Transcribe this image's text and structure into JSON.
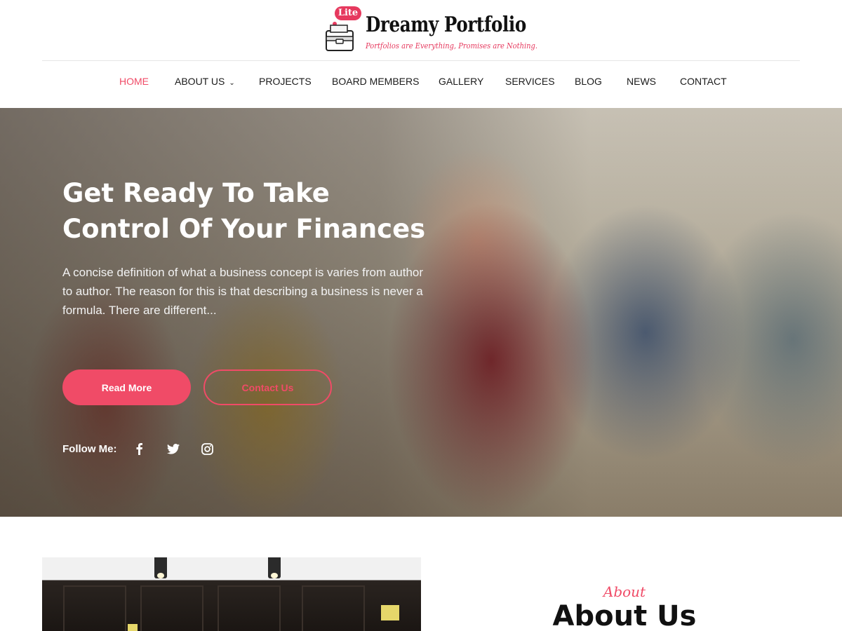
{
  "brand": {
    "badge": "Lite",
    "name": "Dreamy Portfolio",
    "tagline": "Portfolios are Everything, Promises are Nothing."
  },
  "nav": {
    "items": [
      {
        "label": "HOME",
        "active": true
      },
      {
        "label": "ABOUT US",
        "has_dropdown": true
      },
      {
        "label": "PROJECTS"
      },
      {
        "label": "BOARD MEMBERS"
      },
      {
        "label": "GALLERY"
      },
      {
        "label": "SERVICES"
      },
      {
        "label": "BLOG"
      },
      {
        "label": "NEWS"
      },
      {
        "label": "CONTACT"
      }
    ]
  },
  "hero": {
    "title": "Get Ready To Take Control Of Your Finances",
    "text": "A concise definition of what a business concept is varies from author to author. The reason for this is that describing a business is never a formula. There are different...",
    "primary_button": "Read More",
    "secondary_button": "Contact Us",
    "follow_label": "Follow Me:",
    "social_icons": [
      "facebook-icon",
      "twitter-icon",
      "instagram-icon"
    ]
  },
  "about": {
    "eyebrow": "About",
    "title": "About Us"
  },
  "colors": {
    "accent": "#f04b67",
    "text": "#1a1a1a",
    "white": "#ffffff"
  }
}
